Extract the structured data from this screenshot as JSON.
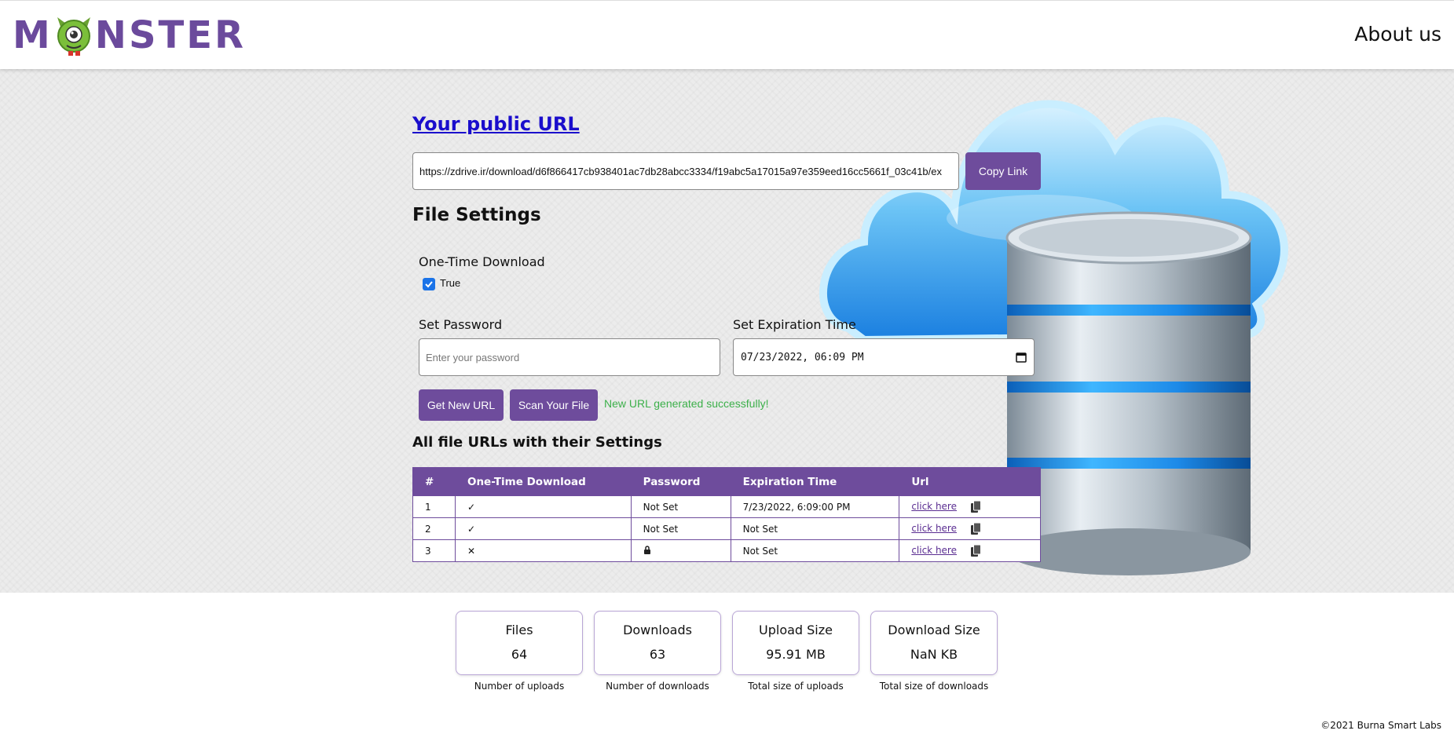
{
  "header": {
    "logo_text": "MONSTER",
    "about_label": "About us"
  },
  "main": {
    "public_url_heading": "Your public URL",
    "public_url_value": "https://zdrive.ir/download/d6f866417cb938401ac7db28abcc3334/f19abc5a17015a97e359eed16cc5661f_03c41b/ex",
    "copy_link_label": "Copy Link",
    "file_settings_heading": "File Settings",
    "one_time_label": "One-Time Download",
    "one_time_option_label": "True",
    "password_label": "Set Password",
    "password_placeholder": "Enter your password",
    "expiration_label": "Set Expiration Time",
    "expiration_value": "07/23/2022, 06:09 PM",
    "get_new_url_label": "Get New URL",
    "scan_file_label": "Scan Your File",
    "success_message": "New URL generated successfully!",
    "all_urls_heading": "All file URLs with their Settings"
  },
  "table": {
    "headers": [
      "#",
      "One-Time Download",
      "Password",
      "Expiration Time",
      "Url"
    ],
    "rows": [
      {
        "num": "1",
        "one_time": "✓",
        "password": "Not Set",
        "expiration": "7/23/2022, 6:09:00 PM",
        "url": "click here"
      },
      {
        "num": "2",
        "one_time": "✓",
        "password": "Not Set",
        "expiration": "Not Set",
        "url": "click here"
      },
      {
        "num": "3",
        "one_time": "✕",
        "password": "lock-icon",
        "expiration": "Not Set",
        "url": "click here"
      }
    ]
  },
  "stats": [
    {
      "title": "Files",
      "value": "64",
      "desc": "Number of uploads"
    },
    {
      "title": "Downloads",
      "value": "63",
      "desc": "Number of downloads"
    },
    {
      "title": "Upload Size",
      "value": "95.91 MB",
      "desc": "Total size of uploads"
    },
    {
      "title": "Download Size",
      "value": "NaN KB",
      "desc": "Total size of downloads"
    }
  ],
  "footer": {
    "copyright": "©2021 Burna Smart Labs"
  },
  "colors": {
    "brand_purple": "#6e4c9c",
    "link_blue": "#1a0dcc",
    "success_green": "#3cb04a"
  }
}
